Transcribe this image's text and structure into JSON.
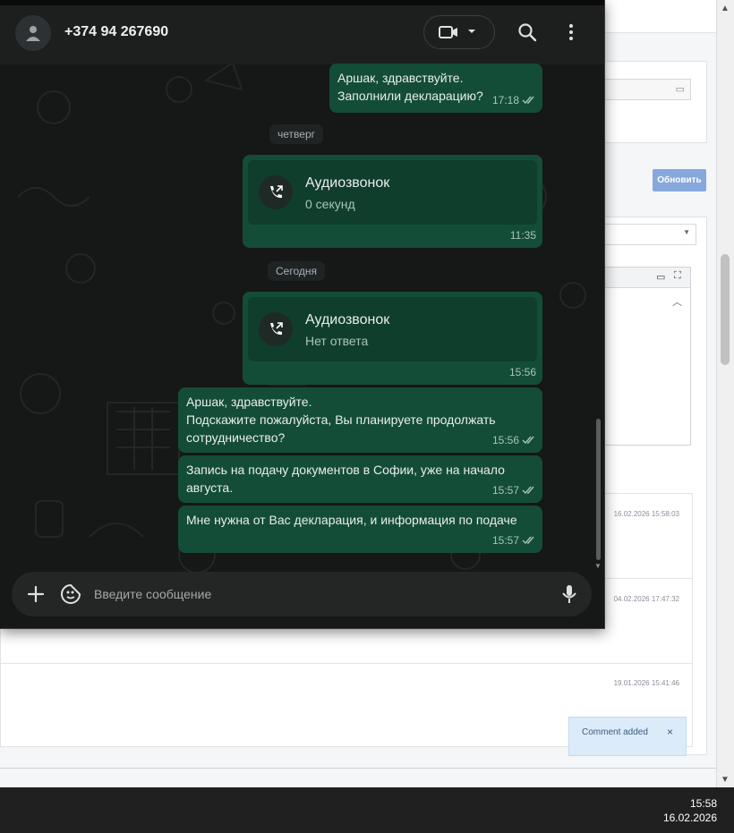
{
  "header": {
    "contact_name": "+374 94 267690",
    "avatar_icon": "person-icon",
    "video_call_icon": "video-camera-icon",
    "search_icon": "search-icon",
    "menu_icon": "kebab-menu-icon"
  },
  "messages": [
    {
      "text": "Аршак, здравствуйте.\nЗаполнили декларацию?",
      "time": "17:18"
    },
    {
      "day": "четверг"
    },
    {
      "call_title": "Аудиозвонок",
      "call_sub": "0 секунд",
      "time": "11:35"
    },
    {
      "day": "Сегодня"
    },
    {
      "call_title": "Аудиозвонок",
      "call_sub": "Нет ответа",
      "time": "15:56"
    },
    {
      "text": "Аршак, здравствуйте.\nПодскажите пожалуйста, Вы планируете продолжать сотрудничество?",
      "time": "15:56"
    },
    {
      "text": "Запись на подачу документов в Софии, уже на начало августа.",
      "time": "15:57"
    },
    {
      "text": "Мне нужна от Вас декларация, и информация по подаче",
      "time": "15:57"
    }
  ],
  "composer": {
    "placeholder": "Введите сообщение",
    "attach_icon": "plus-icon",
    "emoji_icon": "sticker-icon",
    "mic_icon": "microphone-icon"
  },
  "background_page": {
    "refresh_label": "Обновить",
    "timestamps": [
      "16.02.2026 15:58:03",
      "04.02.2026 17:47:32",
      "19.01.2026 15:41:46"
    ],
    "toast_text": "Comment added",
    "toast_close": "×"
  },
  "taskbar": {
    "time": "15:58",
    "date": "16.02.2026"
  },
  "colors": {
    "outgoing_bubble": "#144d37",
    "chat_background": "#161717",
    "accent_refresh": "#86a8dc"
  }
}
